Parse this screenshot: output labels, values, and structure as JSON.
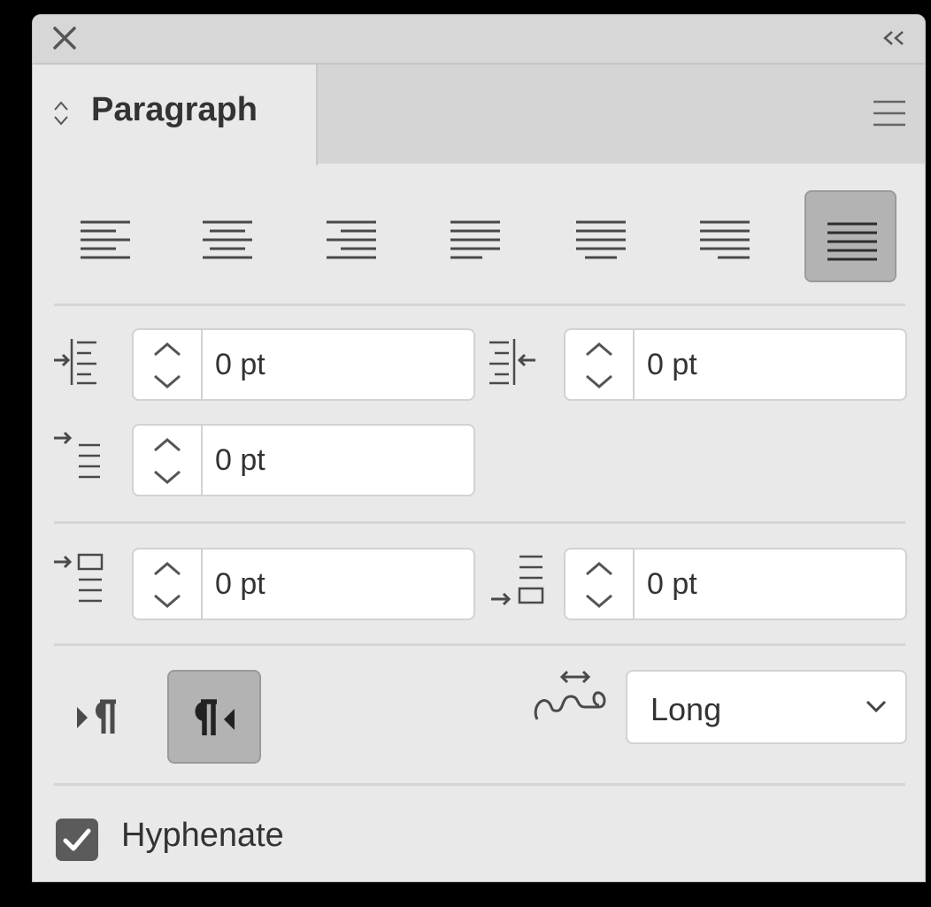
{
  "panel": {
    "tab_title": "Paragraph",
    "icons": {
      "close": "close-icon",
      "collapse": "double-chevron-left-icon",
      "menu": "hamburger-menu-icon",
      "tab_toggle": "up-down-chevron-icon"
    }
  },
  "alignment": {
    "buttons": [
      {
        "name": "align-left",
        "active": false
      },
      {
        "name": "align-center",
        "active": false
      },
      {
        "name": "align-right",
        "active": false
      },
      {
        "name": "justify-last-left",
        "active": false
      },
      {
        "name": "justify-last-center",
        "active": false
      },
      {
        "name": "justify-last-right",
        "active": false
      },
      {
        "name": "justify-all",
        "active": true
      }
    ]
  },
  "indents": {
    "left_indent": "0 pt",
    "right_indent": "0 pt",
    "first_line_indent": "0 pt"
  },
  "spacing": {
    "space_before": "0 pt",
    "space_after": "0 pt"
  },
  "direction": {
    "ltr_active": false,
    "rtl_active": true
  },
  "kashida": {
    "value": "Long"
  },
  "hyphenate": {
    "label": "Hyphenate",
    "checked": true
  },
  "colors": {
    "panel_bg": "#e9e9e9",
    "active_btn": "#b3b3b3",
    "icon": "#4a4a4a"
  }
}
